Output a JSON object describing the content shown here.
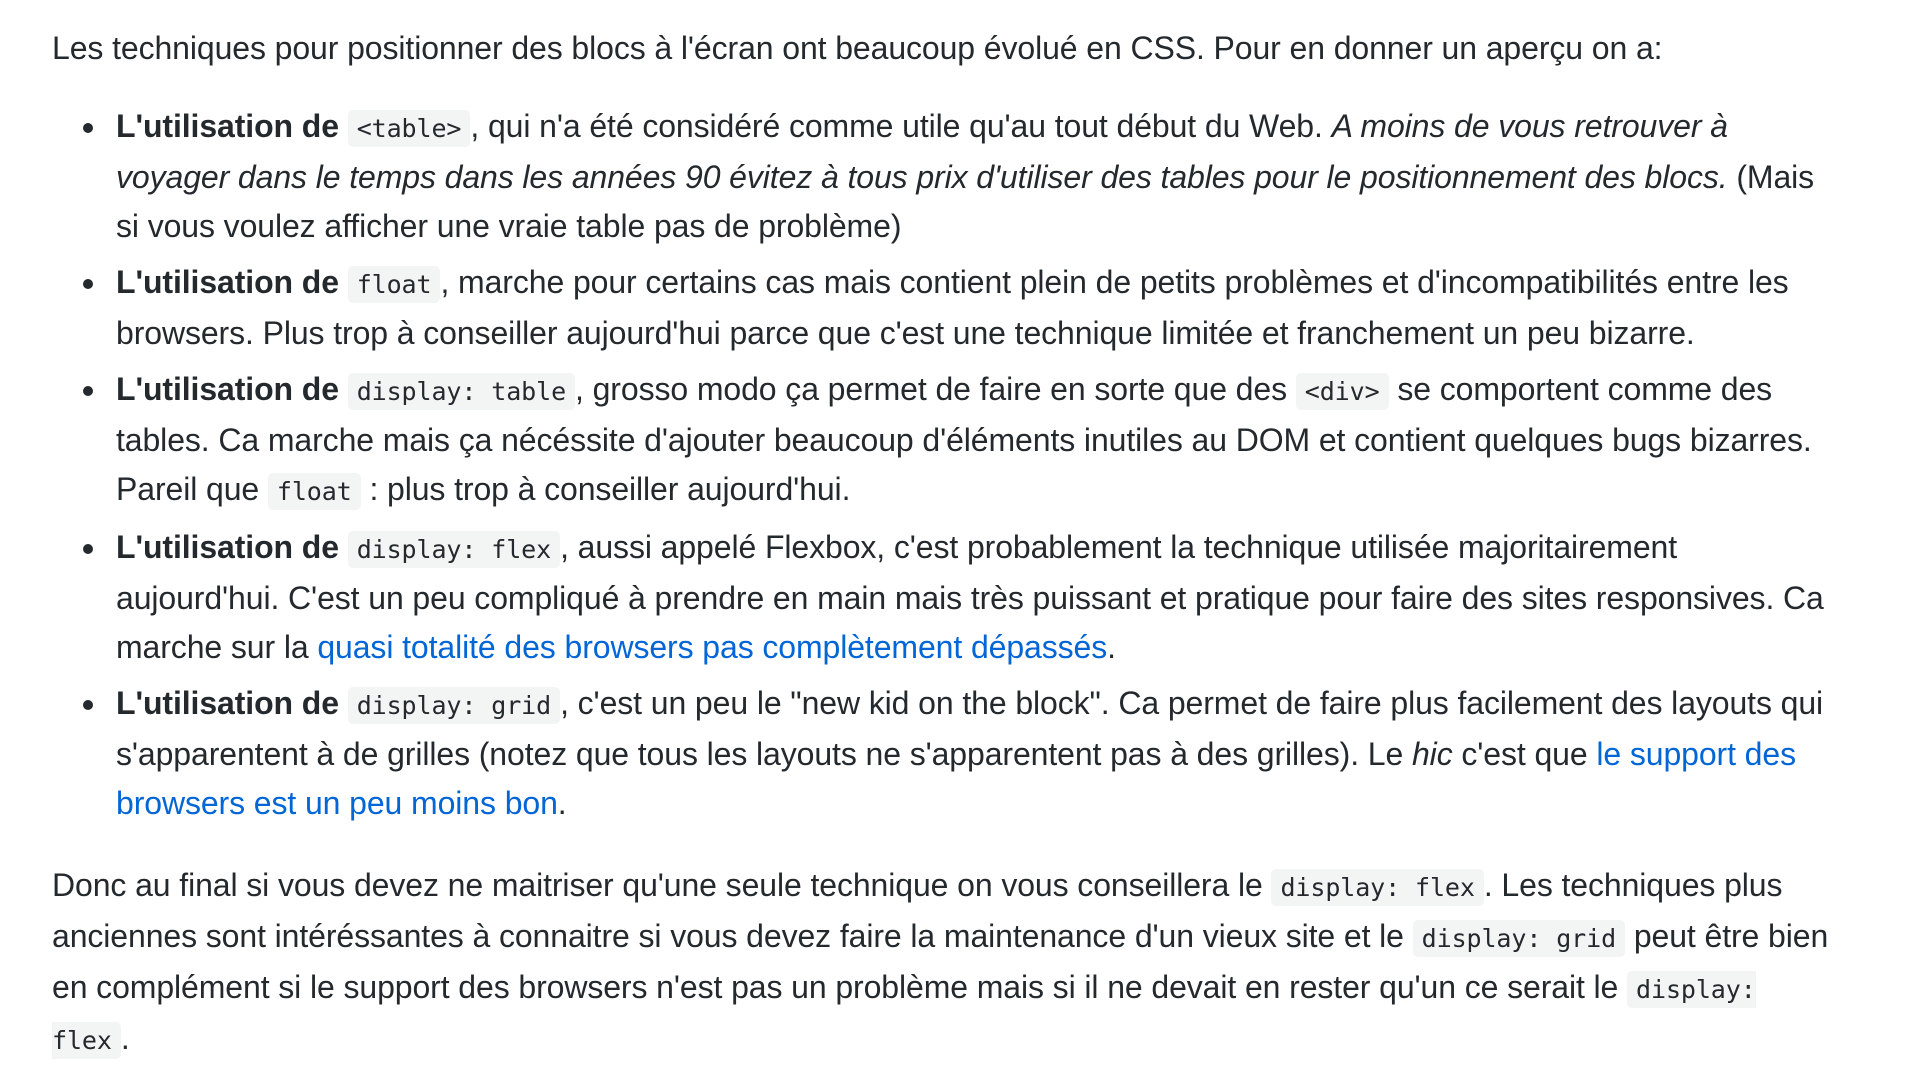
{
  "intro": "Les techniques pour positionner des blocs à l'écran ont beaucoup évolué en CSS. Pour en donner un aperçu on a:",
  "items": [
    {
      "lead": "L'utilisation de",
      "code": "<table>",
      "text": ", qui n'a été considéré comme utile qu'au tout début du Web. ",
      "emph": "A moins de vous retrouver à voyager dans le temps dans les années 90 évitez à tous prix d'utiliser des tables pour le positionnement des blocs.",
      "tail": " (Mais si vous voulez afficher une vraie table pas de problème)"
    },
    {
      "lead": "L'utilisation de",
      "code": "float",
      "text": ", marche pour certains cas mais contient plein de petits problèmes et d'incompatibilités entre les browsers. Plus trop à conseiller aujourd'hui parce que c'est une technique limitée et franchement un peu bizarre."
    },
    {
      "lead": "L'utilisation de",
      "code": "display: table",
      "text": ", grosso modo ça permet de faire en sorte que des ",
      "code2": "<div>",
      "text2": " se comportent comme des tables. Ca marche mais ça nécéssite d'ajouter beaucoup d'éléments inutiles au DOM et contient quelques bugs bizarres. Pareil que ",
      "code3": "float",
      "text3": " : plus trop à conseiller aujourd'hui."
    },
    {
      "lead": "L'utilisation de",
      "code": "display: flex",
      "text": ", aussi appelé Flexbox, c'est probablement la technique utilisée majoritairement aujourd'hui. C'est un peu compliqué à prendre en main mais très puissant et pratique pour faire des sites responsives. Ca marche sur la ",
      "link": "quasi totalité des browsers pas complètement dépassés",
      "tail": "."
    },
    {
      "lead": "L'utilisation de",
      "code": "display: grid",
      "text": ", c'est un peu le \"new kid on the block\". Ca permet de faire plus facilement des layouts qui s'apparentent à de grilles (notez que tous les layouts ne s'apparentent pas à des grilles). Le ",
      "emph": "hic",
      "text2": " c'est que ",
      "link": "le support des browsers est un peu moins bon",
      "tail": "."
    }
  ],
  "conclusion": {
    "text1": "Donc au final si vous devez ne maitriser qu'une seule technique on vous conseillera le ",
    "code1": "display: flex",
    "text2": ". Les techniques plus anciennes sont intéréssantes à connaitre si vous devez faire la maintenance d'un vieux site et le ",
    "code2": "display: grid",
    "text3": " peut être bien en complément si le support des browsers n'est pas un problème mais si il ne devait en rester qu'un ce serait le ",
    "code3": "display: flex",
    "text4": "."
  },
  "colors": {
    "text": "#24292e",
    "link": "#0366d6",
    "code_bg": "#f3f4f4"
  }
}
